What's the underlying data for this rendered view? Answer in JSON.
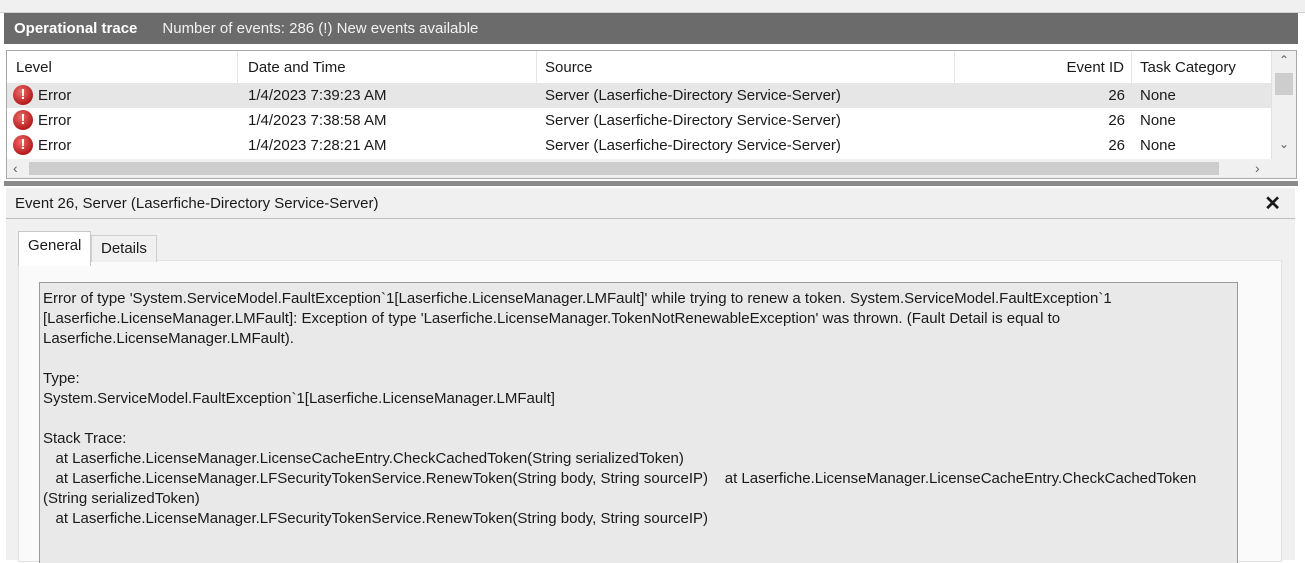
{
  "header": {
    "title": "Operational trace",
    "count": "Number of events: 286 (!) New events available"
  },
  "grid": {
    "columns": [
      "Level",
      "Date and Time",
      "Source",
      "Event ID",
      "Task Category"
    ],
    "rows": [
      {
        "level": "Error",
        "datetime": "1/4/2023 7:39:23 AM",
        "source": "Server (Laserfiche-Directory Service-Server)",
        "event_id": "26",
        "task_category": "None",
        "icon": "error-icon"
      },
      {
        "level": "Error",
        "datetime": "1/4/2023 7:38:58 AM",
        "source": "Server (Laserfiche-Directory Service-Server)",
        "event_id": "26",
        "task_category": "None",
        "icon": "error-icon"
      },
      {
        "level": "Error",
        "datetime": "1/4/2023 7:28:21 AM",
        "source": "Server (Laserfiche-Directory Service-Server)",
        "event_id": "26",
        "task_category": "None",
        "icon": "error-icon"
      }
    ]
  },
  "detail": {
    "title": "Event 26, Server (Laserfiche-Directory Service-Server)",
    "close_glyph": "✕",
    "tabs": [
      "General",
      "Details"
    ],
    "text": "Error of type 'System.ServiceModel.FaultException`1[Laserfiche.LicenseManager.LMFault]' while trying to renew a token. System.ServiceModel.FaultException`1\n[Laserfiche.LicenseManager.LMFault]: Exception of type 'Laserfiche.LicenseManager.TokenNotRenewableException' was thrown. (Fault Detail is equal to\nLaserfiche.LicenseManager.LMFault).\n\nType:\nSystem.ServiceModel.FaultException`1[Laserfiche.LicenseManager.LMFault]\n\nStack Trace:\n   at Laserfiche.LicenseManager.LicenseCacheEntry.CheckCachedToken(String serializedToken)\n   at Laserfiche.LicenseManager.LFSecurityTokenService.RenewToken(String body, String sourceIP)    at Laserfiche.LicenseManager.LicenseCacheEntry.CheckCachedToken\n(String serializedToken)\n   at Laserfiche.LicenseManager.LFSecurityTokenService.RenewToken(String body, String sourceIP)"
  },
  "colors": {
    "title_bar": "#6b6b6b",
    "selected_row": "#e6e6e6",
    "error_red": "#c42b1c"
  }
}
